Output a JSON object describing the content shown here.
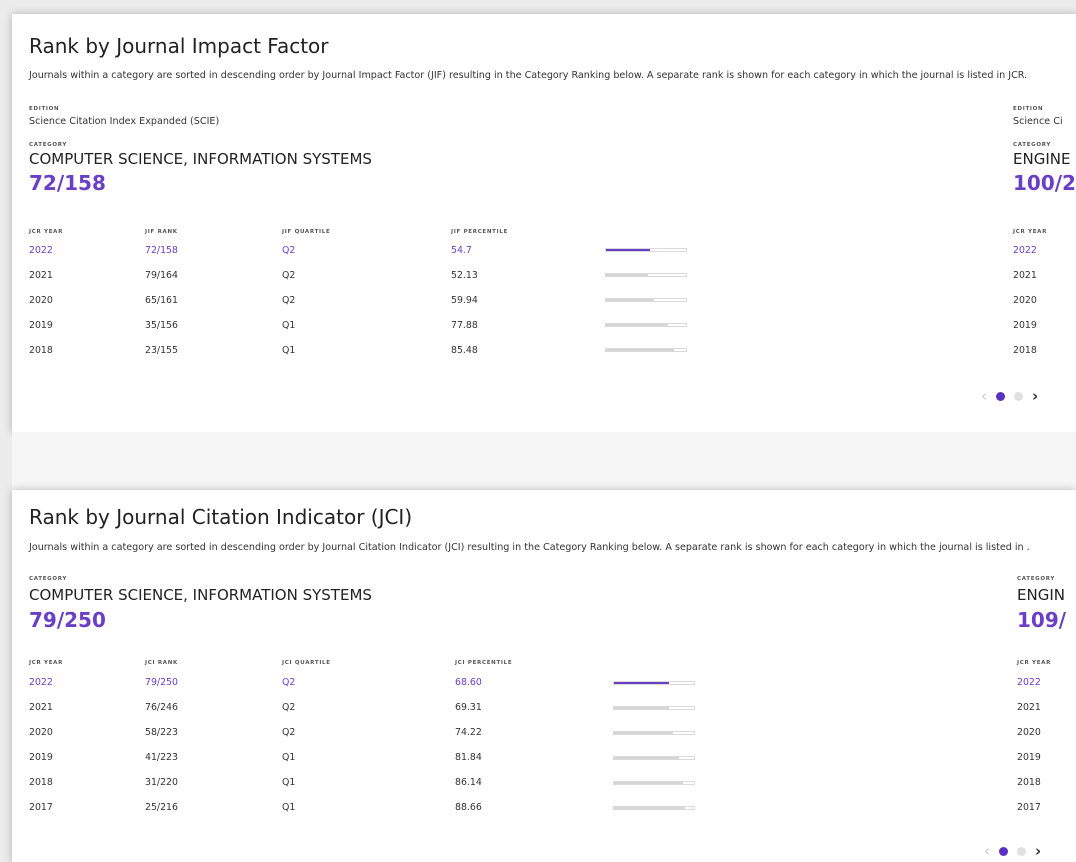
{
  "jif": {
    "title": "Rank by Journal Impact Factor",
    "description": "Journals within a category are sorted in descending order by Journal Impact Factor (JIF) resulting in the Category Ranking below. A separate rank is shown for each category in which the journal is listed in JCR.",
    "edition_label": "EDITION",
    "edition": "Science Citation Index Expanded (SCIE)",
    "category_label": "CATEGORY",
    "category": "COMPUTER SCIENCE, INFORMATION SYSTEMS",
    "category_rank": "72/158",
    "columns": [
      "JCR YEAR",
      "JIF RANK",
      "JIF QUARTILE",
      "JIF PERCENTILE"
    ],
    "rows": [
      {
        "year": "2022",
        "rank": "72/158",
        "quartile": "Q2",
        "percentile": "54.7",
        "pct": 54.7
      },
      {
        "year": "2021",
        "rank": "79/164",
        "quartile": "Q2",
        "percentile": "52.13",
        "pct": 52.13
      },
      {
        "year": "2020",
        "rank": "65/161",
        "quartile": "Q2",
        "percentile": "59.94",
        "pct": 59.94
      },
      {
        "year": "2019",
        "rank": "35/156",
        "quartile": "Q1",
        "percentile": "77.88",
        "pct": 77.88
      },
      {
        "year": "2018",
        "rank": "23/155",
        "quartile": "Q1",
        "percentile": "85.48",
        "pct": 85.48
      }
    ],
    "right": {
      "edition_label": "EDITION",
      "edition": "Science Ci",
      "category_label": "CATEGORY",
      "category": "ENGINE",
      "category_rank": "100/2",
      "col": "JCR YEAR",
      "years": [
        "2022",
        "2021",
        "2020",
        "2019",
        "2018"
      ]
    },
    "pager": {
      "prev": "‹",
      "next": "›",
      "pages": 2,
      "active": 1
    }
  },
  "jci": {
    "title": "Rank by Journal Citation Indicator (JCI)",
    "description": "Journals within a category are sorted in descending order by Journal Citation Indicator (JCI) resulting in the Category Ranking below. A separate rank is shown for each category in which the journal is listed in .",
    "category_label": "CATEGORY",
    "category": "COMPUTER SCIENCE, INFORMATION SYSTEMS",
    "category_rank": "79/250",
    "columns": [
      "JCR YEAR",
      "JCI RANK",
      "JCI QUARTILE",
      "JCI PERCENTILE"
    ],
    "rows": [
      {
        "year": "2022",
        "rank": "79/250",
        "quartile": "Q2",
        "percentile": "68.60",
        "pct": 68.6
      },
      {
        "year": "2021",
        "rank": "76/246",
        "quartile": "Q2",
        "percentile": "69.31",
        "pct": 69.31
      },
      {
        "year": "2020",
        "rank": "58/223",
        "quartile": "Q2",
        "percentile": "74.22",
        "pct": 74.22
      },
      {
        "year": "2019",
        "rank": "41/223",
        "quartile": "Q1",
        "percentile": "81.84",
        "pct": 81.84
      },
      {
        "year": "2018",
        "rank": "31/220",
        "quartile": "Q1",
        "percentile": "86.14",
        "pct": 86.14
      },
      {
        "year": "2017",
        "rank": "25/216",
        "quartile": "Q1",
        "percentile": "88.66",
        "pct": 88.66
      }
    ],
    "right": {
      "category_label": "CATEGORY",
      "category": "ENGIN",
      "category_rank": "109/",
      "col": "JCR YEAR",
      "years": [
        "2022",
        "2021",
        "2020",
        "2019",
        "2018",
        "2017"
      ]
    },
    "pager": {
      "prev": "‹",
      "next": "›",
      "pages": 2,
      "active": 1
    }
  },
  "colors": {
    "accent": "#6b3ec8",
    "dot_active": "#5a2fc2",
    "bar_track": "#d6d6d6"
  }
}
